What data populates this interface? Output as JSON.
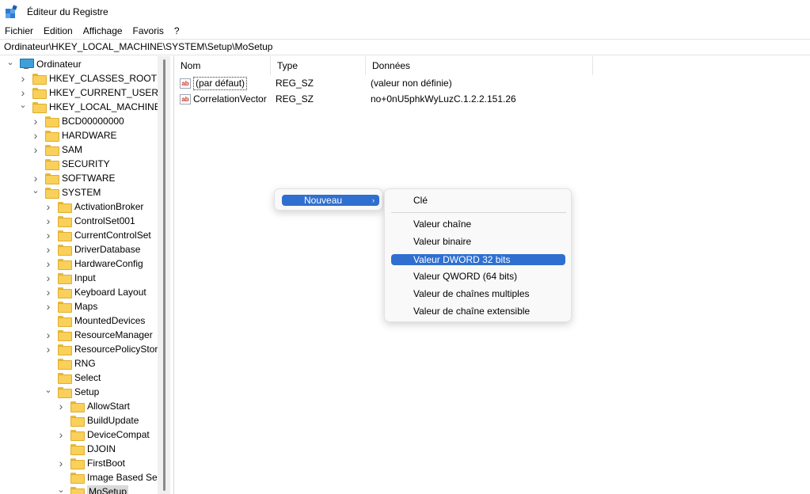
{
  "window": {
    "title": "Éditeur du Registre"
  },
  "menubar": {
    "items": [
      "Fichier",
      "Edition",
      "Affichage",
      "Favoris",
      "?"
    ]
  },
  "address": {
    "path": "Ordinateur\\HKEY_LOCAL_MACHINE\\SYSTEM\\Setup\\MoSetup"
  },
  "tree": {
    "items": [
      {
        "label": "Ordinateur",
        "state": "expanded",
        "icon": "computer-icon"
      },
      {
        "label": "HKEY_CLASSES_ROOT",
        "state": "collapsed",
        "icon": "folder-icon"
      },
      {
        "label": "HKEY_CURRENT_USER",
        "state": "collapsed",
        "icon": "folder-icon"
      },
      {
        "label": "HKEY_LOCAL_MACHINE",
        "state": "expanded",
        "icon": "folder-icon"
      },
      {
        "label": "BCD00000000",
        "state": "collapsed",
        "icon": "folder-icon"
      },
      {
        "label": "HARDWARE",
        "state": "collapsed",
        "icon": "folder-icon"
      },
      {
        "label": "SAM",
        "state": "collapsed",
        "icon": "folder-icon"
      },
      {
        "label": "SECURITY",
        "state": "leaf",
        "icon": "folder-icon"
      },
      {
        "label": "SOFTWARE",
        "state": "collapsed",
        "icon": "folder-icon"
      },
      {
        "label": "SYSTEM",
        "state": "expanded",
        "icon": "folder-icon"
      },
      {
        "label": "ActivationBroker",
        "state": "collapsed",
        "icon": "folder-icon"
      },
      {
        "label": "ControlSet001",
        "state": "collapsed",
        "icon": "folder-icon"
      },
      {
        "label": "CurrentControlSet",
        "state": "collapsed",
        "icon": "folder-icon"
      },
      {
        "label": "DriverDatabase",
        "state": "collapsed",
        "icon": "folder-icon"
      },
      {
        "label": "HardwareConfig",
        "state": "collapsed",
        "icon": "folder-icon"
      },
      {
        "label": "Input",
        "state": "collapsed",
        "icon": "folder-icon"
      },
      {
        "label": "Keyboard Layout",
        "state": "collapsed",
        "icon": "folder-icon"
      },
      {
        "label": "Maps",
        "state": "collapsed",
        "icon": "folder-icon"
      },
      {
        "label": "MountedDevices",
        "state": "leaf",
        "icon": "folder-icon"
      },
      {
        "label": "ResourceManager",
        "state": "collapsed",
        "icon": "folder-icon"
      },
      {
        "label": "ResourcePolicyStore",
        "state": "collapsed",
        "icon": "folder-icon"
      },
      {
        "label": "RNG",
        "state": "leaf",
        "icon": "folder-icon"
      },
      {
        "label": "Select",
        "state": "leaf",
        "icon": "folder-icon"
      },
      {
        "label": "Setup",
        "state": "expanded",
        "icon": "folder-icon"
      },
      {
        "label": "AllowStart",
        "state": "collapsed",
        "icon": "folder-icon"
      },
      {
        "label": "BuildUpdate",
        "state": "leaf",
        "icon": "folder-icon"
      },
      {
        "label": "DeviceCompat",
        "state": "collapsed",
        "icon": "folder-icon"
      },
      {
        "label": "DJOIN",
        "state": "leaf",
        "icon": "folder-icon"
      },
      {
        "label": "FirstBoot",
        "state": "collapsed",
        "icon": "folder-icon"
      },
      {
        "label": "Image Based Setu",
        "state": "leaf",
        "icon": "folder-icon"
      },
      {
        "label": "MoSetup",
        "state": "expanded",
        "icon": "folder-icon",
        "selected": true
      }
    ]
  },
  "list": {
    "columns": [
      "Nom",
      "Type",
      "Données"
    ],
    "rows": [
      {
        "name": "(par défaut)",
        "type": "REG_SZ",
        "data": "(valeur non définie)",
        "icon": "ab-string-icon"
      },
      {
        "name": "CorrelationVector",
        "type": "REG_SZ",
        "data": "no+0nU5phkWyLuzC.1.2.2.151.26",
        "icon": "ab-string-icon"
      }
    ]
  },
  "context_menu": {
    "nouveau_label": "Nouveau",
    "submenu_arrow": "›"
  },
  "submenu": {
    "items": [
      {
        "label": "Clé"
      },
      {
        "label": "Valeur chaîne"
      },
      {
        "label": "Valeur binaire"
      },
      {
        "label": "Valeur DWORD 32 bits",
        "highlighted": true
      },
      {
        "label": "Valeur QWORD (64 bits)"
      },
      {
        "label": "Valeur de chaînes multiples"
      },
      {
        "label": "Valeur de chaîne extensible"
      }
    ]
  },
  "colors": {
    "highlight": "#2f6fd0",
    "folder": "#f8d05a",
    "selection": "#d9d9d9"
  }
}
